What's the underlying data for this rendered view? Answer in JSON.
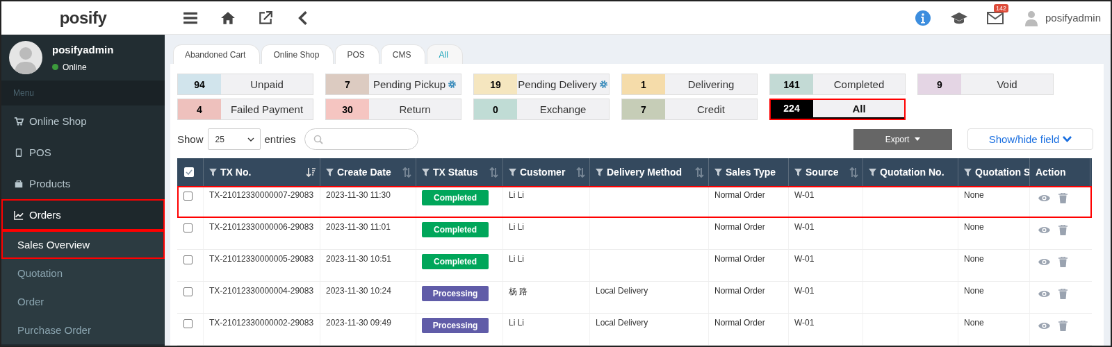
{
  "topbar": {
    "logo": "posify",
    "mail_count": "142",
    "username": "posifyadmin"
  },
  "sidebar": {
    "user": {
      "name": "posifyadmin",
      "status": "Online",
      "online": true
    },
    "menu_label": "Menu",
    "items": [
      {
        "label": "Online Shop",
        "selected": false,
        "highlighted": false
      },
      {
        "label": "POS",
        "selected": false,
        "highlighted": false
      },
      {
        "label": "Products",
        "selected": false,
        "highlighted": false
      },
      {
        "label": "Orders",
        "selected": true,
        "highlighted": true,
        "children": [
          {
            "label": "Sales Overview",
            "selected": true,
            "highlighted": true
          },
          {
            "label": "Quotation",
            "selected": false,
            "highlighted": false
          },
          {
            "label": "Order",
            "selected": false,
            "highlighted": false
          },
          {
            "label": "Purchase Order",
            "selected": false,
            "highlighted": false
          }
        ]
      }
    ]
  },
  "tabs": [
    {
      "label": "Abandoned Cart",
      "selected": false
    },
    {
      "label": "Online Shop",
      "selected": false
    },
    {
      "label": "POS",
      "selected": false
    },
    {
      "label": "CMS",
      "selected": false
    },
    {
      "label": "All",
      "selected": true
    }
  ],
  "status_cards": [
    {
      "count": "94",
      "label": "Unpaid",
      "color": "#d1e4ec",
      "settings_icon": false,
      "selected": false,
      "highlighted": false
    },
    {
      "count": "7",
      "label": "Pending Pickup",
      "color": "#dccbc1",
      "settings_icon": true,
      "selected": false,
      "highlighted": false
    },
    {
      "count": "19",
      "label": "Pending Delivery",
      "color": "#f5e6bf",
      "settings_icon": true,
      "selected": false,
      "highlighted": false
    },
    {
      "count": "1",
      "label": "Delivering",
      "color": "#f5dcaa",
      "settings_icon": false,
      "selected": false,
      "highlighted": false
    },
    {
      "count": "141",
      "label": "Completed",
      "color": "#c3dad5",
      "settings_icon": false,
      "selected": false,
      "highlighted": false
    },
    {
      "count": "9",
      "label": "Void",
      "color": "#e4d5e4",
      "settings_icon": false,
      "selected": false,
      "highlighted": false
    },
    {
      "count": "4",
      "label": "Failed Payment",
      "color": "#eec1bd",
      "settings_icon": false,
      "selected": false,
      "highlighted": false
    },
    {
      "count": "30",
      "label": "Return",
      "color": "#f5c5c1",
      "settings_icon": false,
      "selected": false,
      "highlighted": false
    },
    {
      "count": "0",
      "label": "Exchange",
      "color": "#c0dcd5",
      "settings_icon": false,
      "selected": false,
      "highlighted": false
    },
    {
      "count": "7",
      "label": "Credit",
      "color": "#c6cdb7",
      "settings_icon": false,
      "selected": false,
      "highlighted": false
    },
    {
      "count": "224",
      "label": "All",
      "color": "#000000",
      "settings_icon": false,
      "selected": true,
      "highlighted": true
    }
  ],
  "entries": {
    "show_label": "Show",
    "page_size": "25",
    "entries_label": "entries"
  },
  "export_button": "Export",
  "show_hide_button": "Show/hide field",
  "table": {
    "header_checked": true,
    "columns": [
      {
        "label": "TX No.",
        "filter": true,
        "sortable": true,
        "sorted": true
      },
      {
        "label": "Create Date",
        "filter": true,
        "sortable": true,
        "sorted": false
      },
      {
        "label": "TX Status",
        "filter": true,
        "sortable": true,
        "sorted": false
      },
      {
        "label": "Customer",
        "filter": true,
        "sortable": true,
        "sorted": false
      },
      {
        "label": "Delivery Method",
        "filter": true,
        "sortable": true,
        "sorted": false
      },
      {
        "label": "Sales Type",
        "filter": true,
        "sortable": false
      },
      {
        "label": "Source",
        "filter": true,
        "sortable": true,
        "sorted": false
      },
      {
        "label": "Quotation No.",
        "filter": true,
        "sortable": false
      },
      {
        "label": "Quotation S",
        "filter": true,
        "sortable": false
      },
      {
        "label": "Action",
        "filter": false,
        "sortable": false
      }
    ],
    "rows": [
      {
        "checked": false,
        "highlighted": true,
        "tx_no": "TX-21012330000007-29083",
        "create_date": "2023-11-30 11:30",
        "status": {
          "label": "Completed",
          "color": "#00a65a"
        },
        "customer": "Li Li",
        "sales_type": "Normal Order",
        "source": "W-01",
        "quotation_status": "None"
      },
      {
        "checked": false,
        "highlighted": false,
        "tx_no": "TX-21012330000006-29083",
        "create_date": "2023-11-30 11:01",
        "status": {
          "label": "Completed",
          "color": "#00a65a"
        },
        "customer": "Li Li",
        "sales_type": "Normal Order",
        "source": "W-01",
        "quotation_status": "None"
      },
      {
        "checked": false,
        "highlighted": false,
        "tx_no": "TX-21012330000005-29083",
        "create_date": "2023-11-30 10:51",
        "status": {
          "label": "Completed",
          "color": "#00a65a"
        },
        "customer": "Li Li",
        "sales_type": "Normal Order",
        "source": "W-01",
        "quotation_status": "None"
      },
      {
        "checked": false,
        "highlighted": false,
        "tx_no": "TX-21012330000004-29083",
        "create_date": "2023-11-30 10:24",
        "status": {
          "label": "Processing",
          "color": "#605ca8"
        },
        "customer": "杨 路",
        "delivery_method": "Local Delivery",
        "sales_type": "Normal Order",
        "source": "W-01",
        "quotation_status": "None"
      },
      {
        "checked": false,
        "highlighted": false,
        "tx_no": "TX-21012330000002-29083",
        "create_date": "2023-11-30 09:49",
        "status": {
          "label": "Processing",
          "color": "#605ca8"
        },
        "customer": "Li Li",
        "delivery_method": "Local Delivery",
        "sales_type": "Normal Order",
        "source": "W-01",
        "quotation_status": "None"
      }
    ]
  }
}
